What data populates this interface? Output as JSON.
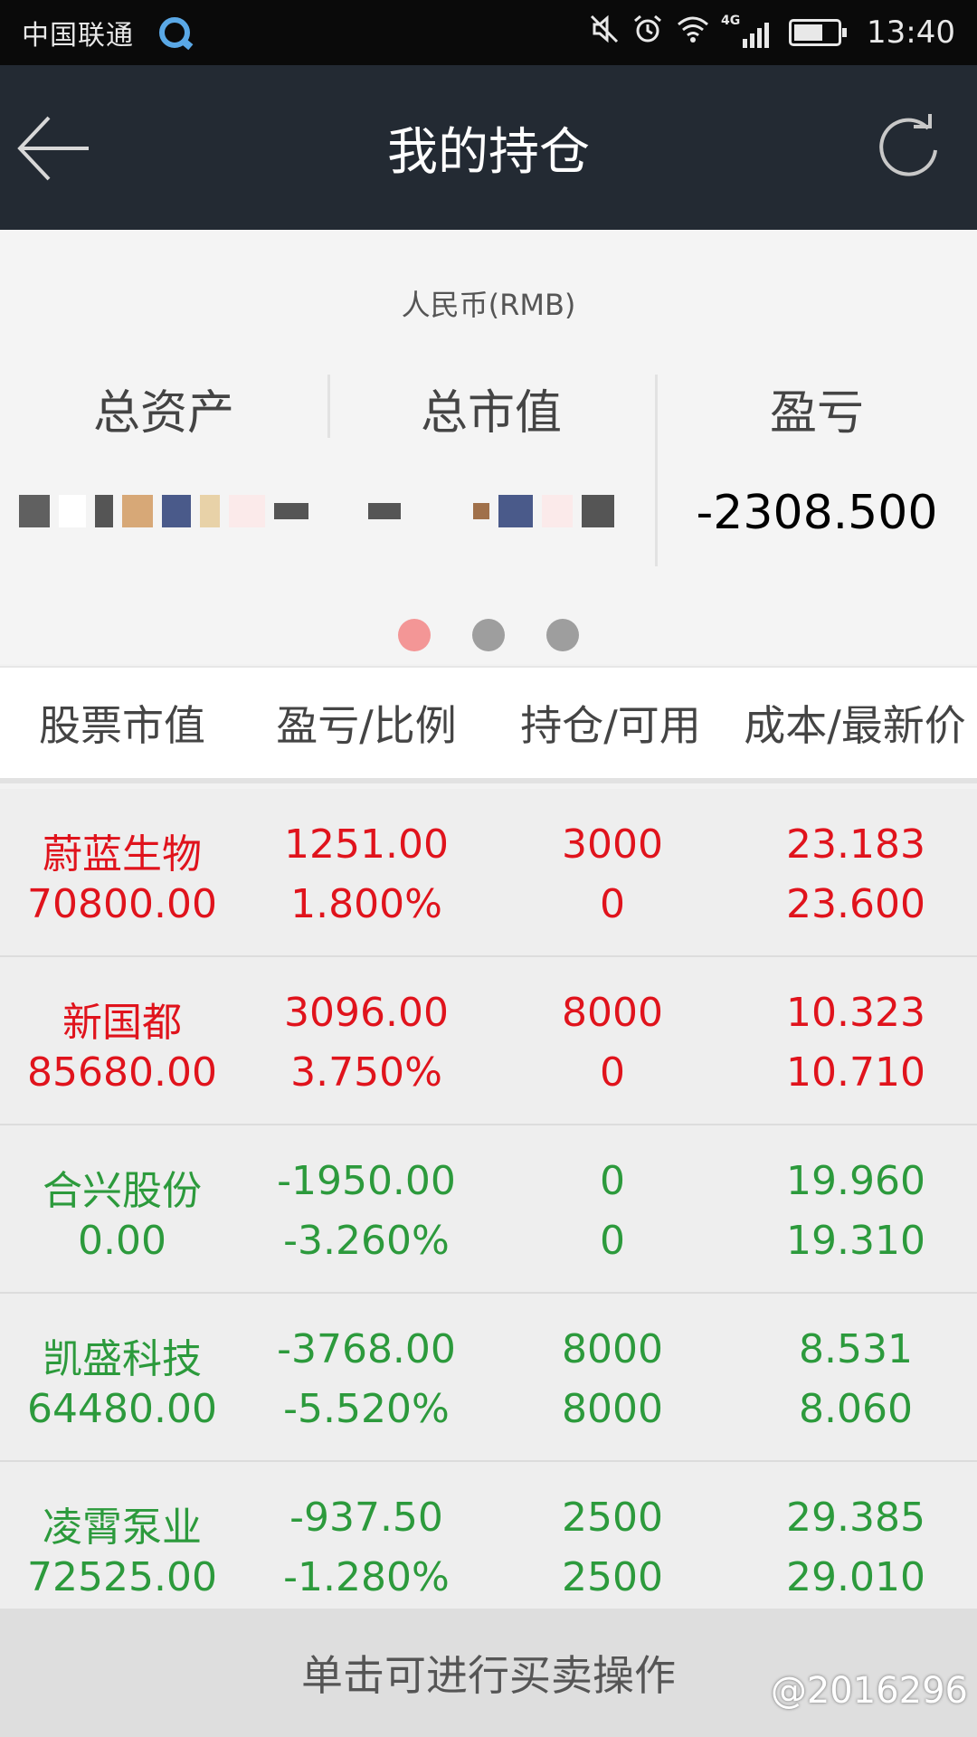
{
  "status_bar": {
    "carrier": "中国联通",
    "network": "4G",
    "time": "13:40",
    "icons": [
      "mute-icon",
      "alarm-icon",
      "wifi-icon",
      "signal-icon",
      "battery-icon"
    ]
  },
  "header": {
    "title": "我的持仓",
    "back_icon": "arrow-left-icon",
    "refresh_icon": "refresh-icon"
  },
  "summary": {
    "currency": "人民币(RMB)",
    "total_assets_label": "总资产",
    "market_value_label": "总市值",
    "pnl_label": "盈亏",
    "pnl_value": "-2308.500",
    "page_count": 3,
    "active_page": 1
  },
  "table": {
    "headers": [
      "股票市值",
      "盈亏/比例",
      "持仓/可用",
      "成本/最新价"
    ],
    "rows": [
      {
        "name": "蔚蓝生物",
        "market_value": "70800.00",
        "pnl": "1251.00",
        "ratio": "1.800%",
        "position": "3000",
        "available": "0",
        "cost": "23.183",
        "latest": "23.600",
        "color": "#e0131c"
      },
      {
        "name": "新国都",
        "market_value": "85680.00",
        "pnl": "3096.00",
        "ratio": "3.750%",
        "position": "8000",
        "available": "0",
        "cost": "10.323",
        "latest": "10.710",
        "color": "#e0131c"
      },
      {
        "name": "合兴股份",
        "market_value": "0.00",
        "pnl": "-1950.00",
        "ratio": "-3.260%",
        "position": "0",
        "available": "0",
        "cost": "19.960",
        "latest": "19.310",
        "color": "#2c9a3c"
      },
      {
        "name": "凯盛科技",
        "market_value": "64480.00",
        "pnl": "-3768.00",
        "ratio": "-5.520%",
        "position": "8000",
        "available": "8000",
        "cost": "8.531",
        "latest": "8.060",
        "color": "#2c9a3c"
      },
      {
        "name": "凌霄泵业",
        "market_value": "72525.00",
        "pnl": "-937.50",
        "ratio": "-1.280%",
        "position": "2500",
        "available": "2500",
        "cost": "29.385",
        "latest": "29.010",
        "color": "#2c9a3c"
      }
    ]
  },
  "footer": {
    "hint": "单击可进行买卖操作",
    "watermark": "@2016296"
  },
  "colors": {
    "up": "#e0131c",
    "down": "#2c9a3c",
    "header_bg": "#232a33",
    "dot_active": "#f39696"
  }
}
